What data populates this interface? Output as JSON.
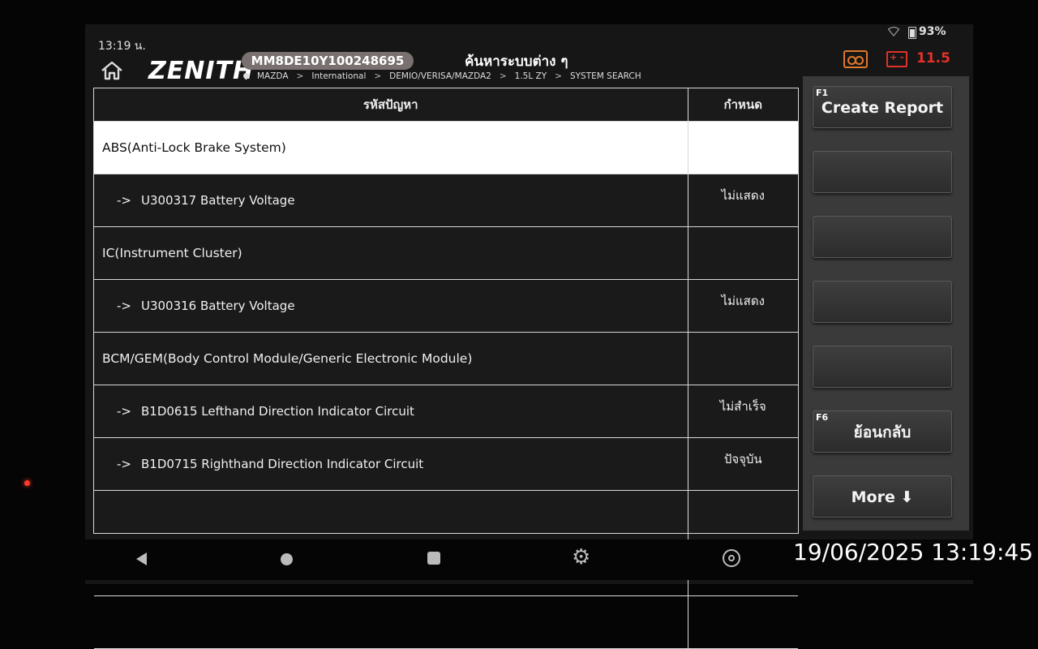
{
  "status_bar": {
    "time": "13:19 น.",
    "battery_pct": "93%"
  },
  "header": {
    "logo": "ZENITH",
    "vin": "MM8DE10Y100248695",
    "title": "ค้นหาระบบต่าง ๆ",
    "breadcrumb": [
      "MAZDA",
      "International",
      "DEMIO/VERISA/MAZDA2",
      "1.5L ZY",
      "SYSTEM SEARCH"
    ],
    "voltage": "11.5"
  },
  "table": {
    "columns": [
      "รหัสปัญหา",
      "กำหนด"
    ],
    "rows": [
      {
        "type": "system",
        "code": "ABS(Anti-Lock Brake System)",
        "status": "",
        "selected": true
      },
      {
        "type": "dtc",
        "prefix": "->",
        "code": "U300317 Battery Voltage",
        "status": "ไม่แสดง"
      },
      {
        "type": "system",
        "code": "IC(Instrument Cluster)",
        "status": ""
      },
      {
        "type": "dtc",
        "prefix": "->",
        "code": "U300316 Battery Voltage",
        "status": "ไม่แสดง"
      },
      {
        "type": "system",
        "code": "BCM/GEM(Body Control Module/Generic Electronic Module)",
        "status": ""
      },
      {
        "type": "dtc",
        "prefix": "->",
        "code": "B1D0615 Lefthand Direction Indicator Circuit",
        "status": "ไม่สำเร็จ"
      },
      {
        "type": "dtc",
        "prefix": "->",
        "code": "B1D0715 Righthand Direction Indicator Circuit",
        "status": "ปัจจุบัน"
      },
      {
        "type": "empty",
        "code": "",
        "status": ""
      },
      {
        "type": "empty",
        "code": "",
        "status": ""
      },
      {
        "type": "empty",
        "code": "",
        "status": ""
      }
    ]
  },
  "function_keys": [
    {
      "key": "F1",
      "label": "Create Report"
    },
    {
      "key": "",
      "label": ""
    },
    {
      "key": "",
      "label": ""
    },
    {
      "key": "",
      "label": ""
    },
    {
      "key": "",
      "label": ""
    },
    {
      "key": "F6",
      "label": "ย้อนกลับ"
    },
    {
      "key": "",
      "label": "More ⬇"
    }
  ],
  "icons": {
    "home": "home-icon",
    "record": "record-icon",
    "car_battery": "car-battery-icon",
    "nav": [
      "back-icon",
      "home-circle-icon",
      "recents-icon",
      "settings-gear-icon",
      "chrome-icon"
    ]
  },
  "colors": {
    "accent_orange": "#e0782a",
    "alert_red": "#e0322a",
    "selected_row": "#ffffff"
  },
  "overlay_timestamp": "19/06/2025 13:19:45"
}
